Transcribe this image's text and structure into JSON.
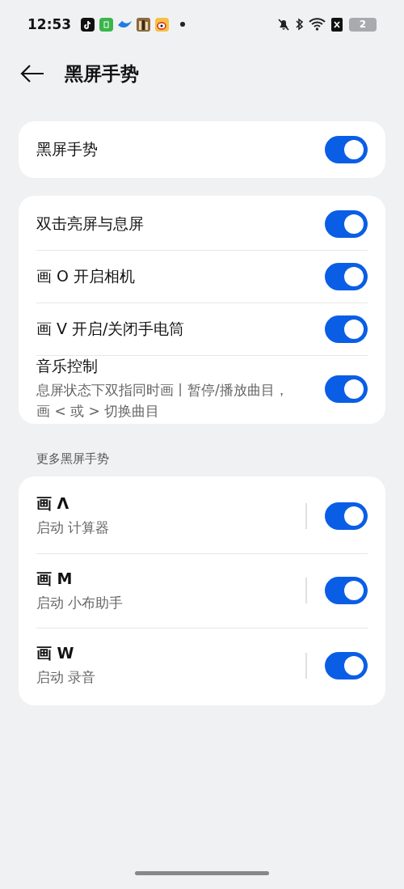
{
  "status_bar": {
    "time": "12:53",
    "battery": "2"
  },
  "header": {
    "title": "黑屏手势"
  },
  "groups": [
    {
      "rows": [
        {
          "kind": "switch",
          "title": "黑屏手势",
          "on": true
        }
      ]
    },
    {
      "rows": [
        {
          "kind": "switch",
          "title": "双击亮屏与息屏",
          "on": true
        },
        {
          "kind": "switch",
          "title": "画 O 开启相机",
          "on": true
        },
        {
          "kind": "switch",
          "title": "画 V 开启/关闭手电筒",
          "on": true
        },
        {
          "kind": "switch",
          "title": "音乐控制",
          "subtitle": "息屏状态下双指同时画丨暂停/播放曲目，画 < 或 > 切换曲目",
          "on": true
        }
      ]
    },
    {
      "label": "更多黑屏手势",
      "rows": [
        {
          "kind": "shortcut",
          "title": "画 Λ",
          "subtitle": "启动 计算器",
          "on": true
        },
        {
          "kind": "shortcut",
          "title": "画 M",
          "subtitle": "启动 小布助手",
          "on": true
        },
        {
          "kind": "shortcut",
          "title": "画 W",
          "subtitle": "启动 录音",
          "on": true
        }
      ]
    }
  ]
}
